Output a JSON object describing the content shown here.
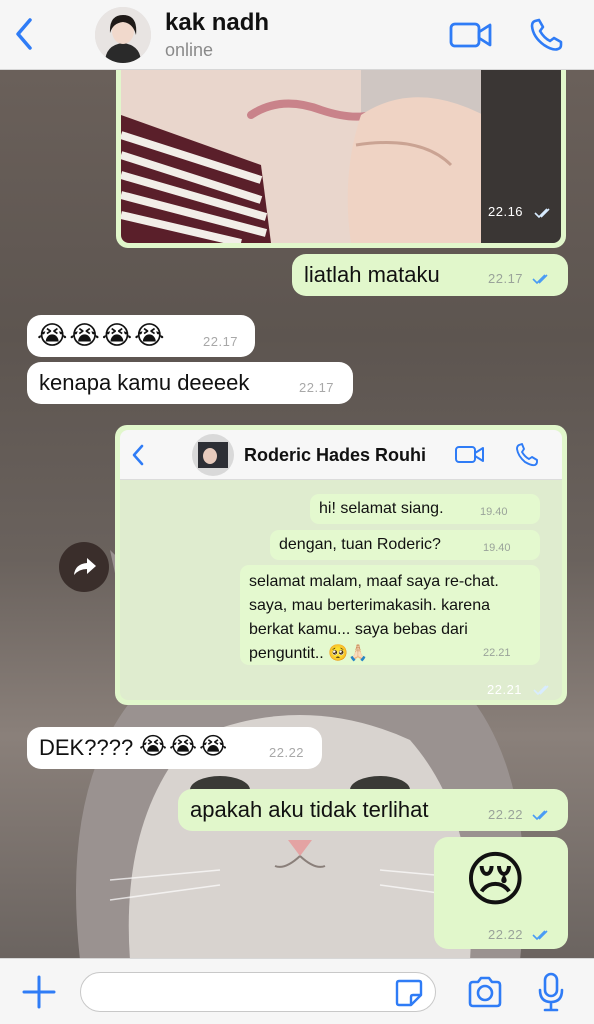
{
  "header": {
    "contact_name": "kak nadh",
    "status": "online",
    "icons": [
      "back-chevron-icon",
      "video-call-icon",
      "phone-icon"
    ]
  },
  "messages": [
    {
      "id": "m1",
      "side": "out",
      "type": "photo",
      "time": "22.16",
      "read": true
    },
    {
      "id": "m2",
      "side": "out",
      "text": "liatlah mataku",
      "time": "22.17",
      "read": true
    },
    {
      "id": "m3",
      "side": "in",
      "emoji": [
        "😭",
        "😭",
        "😭",
        "😭"
      ],
      "time": "22.17"
    },
    {
      "id": "m4",
      "side": "in",
      "text": "kenapa kamu deeeek",
      "time": "22.17"
    },
    {
      "id": "m5",
      "side": "out",
      "type": "screenshot",
      "time": "22.21",
      "read": true
    },
    {
      "id": "m6",
      "side": "in",
      "text": "DEK????",
      "emoji": [
        "😭",
        "😭",
        "😭"
      ],
      "time": "22.22"
    },
    {
      "id": "m7",
      "side": "out",
      "text": "apakah aku tidak terlihat",
      "time": "22.22",
      "read": true
    },
    {
      "id": "m8",
      "side": "out",
      "emoji": [
        "😢"
      ],
      "time": "22.22",
      "read": true
    }
  ],
  "embedded": {
    "contact_name": "Roderic Hades Rouhi",
    "messages": [
      {
        "text": "hi! selamat siang.",
        "time": "19.40"
      },
      {
        "text": "dengan, tuan Roderic?",
        "time": "19.40"
      },
      {
        "text": "selamat malam, maaf saya re-chat. saya, mau berterimakasih. karena berkat kamu... saya bebas dari penguntit.. 🥺🙏🏻",
        "time": "22.21"
      }
    ]
  },
  "footer": {
    "input_placeholder": "",
    "icons": [
      "plus-icon",
      "sticker-icon",
      "camera-icon",
      "microphone-icon"
    ]
  },
  "colors": {
    "accent": "#2f7cf6",
    "outgoing_bubble": "#e1f7cb",
    "incoming_bubble": "#ffffff",
    "tick_blue": "#4a9cf4"
  }
}
